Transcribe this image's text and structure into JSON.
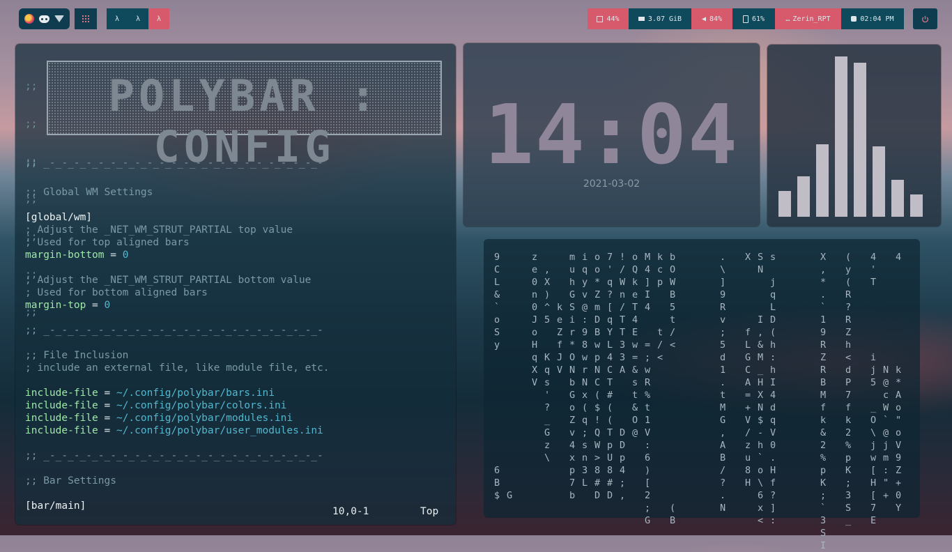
{
  "topbar": {
    "left_icons": [
      "firefox-icon",
      "discord-icon",
      "wifi-icon"
    ],
    "menu_icon": "grid-menu-icon",
    "workspaces": [
      "λ",
      "λ",
      "λ"
    ],
    "active_workspace_index": 2,
    "modules": [
      {
        "name": "cpu",
        "icon": "cpu-icon",
        "label": "44%"
      },
      {
        "name": "memory",
        "icon": "memory-icon",
        "label": "3.07 GiB"
      },
      {
        "name": "volume",
        "icon": "volume-icon",
        "label": "84%"
      },
      {
        "name": "battery",
        "icon": "battery-icon",
        "label": "61%"
      },
      {
        "name": "user",
        "icon": "terminal-icon",
        "label": "Zerin_RPT"
      },
      {
        "name": "clock",
        "icon": "clock-icon",
        "label": "02:04 PM"
      }
    ],
    "power_icon": "power-icon"
  },
  "editor": {
    "banner": "POLYBAR : CONFIG",
    "banner_gutter": [
      ";;",
      ";;",
      ";;",
      ";;",
      ";;",
      ";;",
      ";;"
    ],
    "lines": [
      {
        "type": "comment",
        "text": ";; _-_-_-_-_-_-_-_-_-_-_-_-_-_-_-_-_-_-_-_-_-_-_-"
      },
      {
        "type": "comment",
        "text": ";; Global WM Settings"
      },
      {
        "type": "head",
        "text": "[global/wm]"
      },
      {
        "type": "comment",
        "text": "; Adjust the _NET_WM_STRUT_PARTIAL top value"
      },
      {
        "type": "comment",
        "text": "; Used for top aligned bars"
      },
      {
        "type": "kv",
        "key": "margin-bottom",
        "eq": " = ",
        "val": "0"
      },
      {
        "type": "comment",
        "text": "; Adjust the _NET_WM_STRUT_PARTIAL bottom value"
      },
      {
        "type": "comment",
        "text": "; Used for bottom aligned bars"
      },
      {
        "type": "kv",
        "key": "margin-top",
        "eq": " = ",
        "val": "0"
      },
      {
        "type": "comment",
        "text": ";; _-_-_-_-_-_-_-_-_-_-_-_-_-_-_-_-_-_-_-_-_-_-_-"
      },
      {
        "type": "comment",
        "text": ";; File Inclusion"
      },
      {
        "type": "comment",
        "text": "; include an external file, like module file, etc."
      },
      {
        "type": "kv",
        "key": "include-file",
        "eq": " = ",
        "val": "~/.config/polybar/bars.ini"
      },
      {
        "type": "kv",
        "key": "include-file",
        "eq": " = ",
        "val": "~/.config/polybar/colors.ini"
      },
      {
        "type": "kv",
        "key": "include-file",
        "eq": " = ",
        "val": "~/.config/polybar/modules.ini"
      },
      {
        "type": "kv",
        "key": "include-file",
        "eq": " = ",
        "val": "~/.config/polybar/user_modules.ini"
      },
      {
        "type": "comment",
        "text": ";; _-_-_-_-_-_-_-_-_-_-_-_-_-_-_-_-_-_-_-_-_-_-_-"
      },
      {
        "type": "comment",
        "text": ";; Bar Settings"
      },
      {
        "type": "head",
        "text": "[bar/main]"
      }
    ],
    "status_position": "10,0-1",
    "status_scroll": "Top"
  },
  "clock_widget": {
    "time": "14:04",
    "date": "2021-03-02"
  },
  "visualizer": {
    "levels": [
      0.16,
      0.25,
      0.45,
      1.0,
      0.96,
      0.44,
      0.23,
      0.14
    ]
  },
  "matrix": {
    "columns": [
      "9\nC\nL\n&\n`\no\nS\ny\n\n\n\n\n\n\n\n\n\n6\nB\n$",
      "\n\n\n\n\n\n\n\n\n\n\n\n\n\n\n\n\n\n\nG",
      "z\ne\n0\nn\n0\nJ\no\nH\nq\nX\nV",
      "\n,\nX\n)\n^\n5\n\n\nK\nq\ns\n'\n?\n_\nG\nz\n\\",
      "\n\n\n\nk\ne\nZ\nf\nJ\nV",
      "m\nu\nh\nG\nS\ni\nr\n*\nO\nN\nb\nG\no\nZ\nv\n4\nx\np\n7\nb",
      "i\nq\ny\nv\n@\n:\n9\n8\nw\nr\nN\nx\n(\nq\n;\ns\nn\n3\nL",
      "o\no\n*\nZ\nm\nD\nB\nw\np\nN\nC\n(\n$\n!\nQ\nW\n>\n8\n#\nD",
      "7\n'\nq\n?\n[\nq\nY\nL\n4\nC\nT\n#\n(\n(\nT\np\nU\n8\n#\nD",
      "!\n/\nW\nn\n/\nT\nT\n3\n3\nA\n\n\n\n\nD\nD\np\n4\n;\n,",
      "o\nQ\nk\ne\nT\n4\nE\nw\n=\n&\ns\nt\n&\nO\n@",
      "M\n4\n]\nI\n4\n\n\n=\n;\nw\nR\n%\nt\n1\nV\n:\n6\n)\n[\n2\n;\nG",
      "k\nc\np\n\n\n\nt\n/\n<",
      "b\nO\nW\nB\n5\nt\n/\n<\n\n\n\n\n\n\n\n\n\n\n\n\n(\nB",
      ".\n\\\n]\n9\nR\nv\n;\n5\nd\n1\n.\nt\nM\nG\n,\nA\nB\n/\n?\n.\nN",
      "X\n\n\n\n\n\nf\nL\nG\nC\nA\n=\n+\nV\n/\nz\nu\n8\nH",
      "S\nN\n\n\n\nI\n,\n&\nM\n_\nH\nX\nN\n$\n-\nh\n`\no\n\\\n6\nx\n<",
      "s\n\nj\nq\nL\nD\n(\nh\n:\nh\nI\n4\nd\nq\nV\n0\n.\nH\nf\n?\n]\n:",
      "X\n,\n*\n.\n`\n1\n9\nR\nZ\nR\nB\nM\nf\nk\n&\n2\n%\np\nK\n;\n`\n3\nS\nI",
      "(\ny\n(\nR\n?\nR\nZ\nh\n<\nd\nP\n7\nf\nk\n2\n%\np\nK\n;\n3\nS\n_",
      "4\n'\nT\n\n\n\n\n\ni\nj\n5\n\n_\nO\n\\\nj\nw\n[\nH\n[\n7\nE",
      "\n\n\n\n\n\n\n\n\nN\n@\nc\nW\n`\n@\nj\nm\n:\n\"\n+",
      "4\n\n\n\n\n\n\n\n\nk\n*\nA\no\n\"\no\nV\n9\nZ\n+\n0\nY"
    ]
  }
}
